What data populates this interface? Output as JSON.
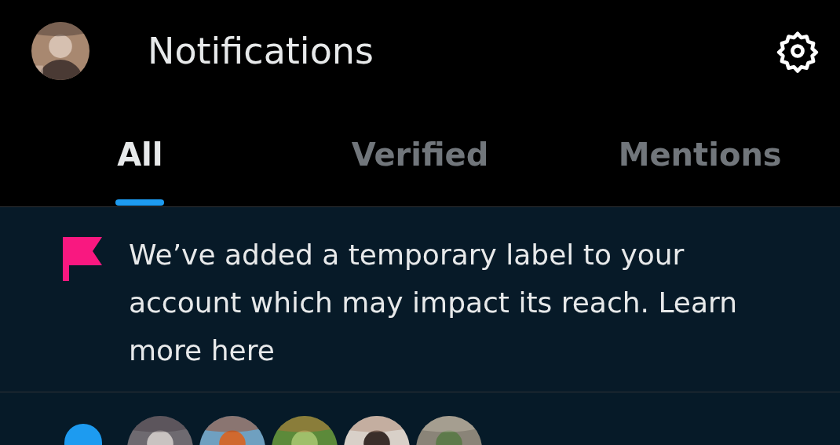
{
  "header": {
    "title": "Notifications"
  },
  "tabs": [
    {
      "label": "All",
      "selected": true
    },
    {
      "label": "Verified",
      "selected": false
    },
    {
      "label": "Mentions",
      "selected": false
    }
  ],
  "notice": {
    "text": "We’ve added a temporary label to your account which may impact its reach. Learn more here"
  }
}
